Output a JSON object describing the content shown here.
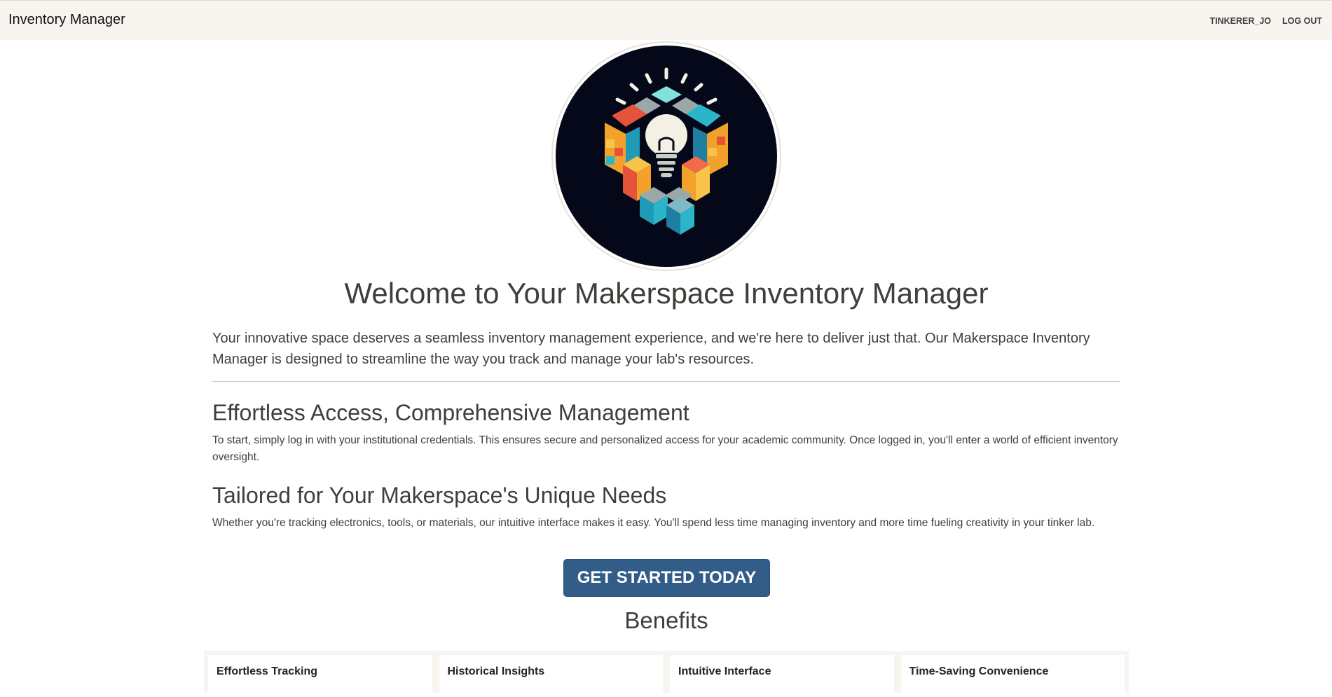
{
  "navbar": {
    "brand": "Inventory Manager",
    "user": "TINKERER_JO",
    "logout": "LOG OUT"
  },
  "hero": {
    "title": "Welcome to Your Makerspace Inventory Manager",
    "lead": "Your innovative space deserves a seamless inventory management experience, and we're here to deliver just that. Our Makerspace Inventory Manager is designed to streamline the way you track and manage your lab's resources."
  },
  "sections": [
    {
      "title": "Effortless Access, Comprehensive Management",
      "text": "To start, simply log in with your institutional credentials. This ensures secure and personalized access for your academic community. Once logged in, you'll enter a world of efficient inventory oversight."
    },
    {
      "title": "Tailored for Your Makerspace's Unique Needs",
      "text": "Whether you're tracking electronics, tools, or materials, our intuitive interface makes it easy. You'll spend less time managing inventory and more time fueling creativity in your tinker lab."
    }
  ],
  "cta": {
    "label": "GET STARTED TODAY"
  },
  "benefits": {
    "title": "Benefits",
    "cards": [
      {
        "title": "Effortless Tracking"
      },
      {
        "title": "Historical Insights"
      },
      {
        "title": "Intuitive Interface"
      },
      {
        "title": "Time-Saving Convenience"
      }
    ]
  },
  "colors": {
    "navbar_bg": "#f8f5f0",
    "primary": "#325d88",
    "text": "#3e3f3a",
    "logo_bg": "#050818"
  },
  "logo": {
    "icon": "lightbulb-cube-logo"
  }
}
